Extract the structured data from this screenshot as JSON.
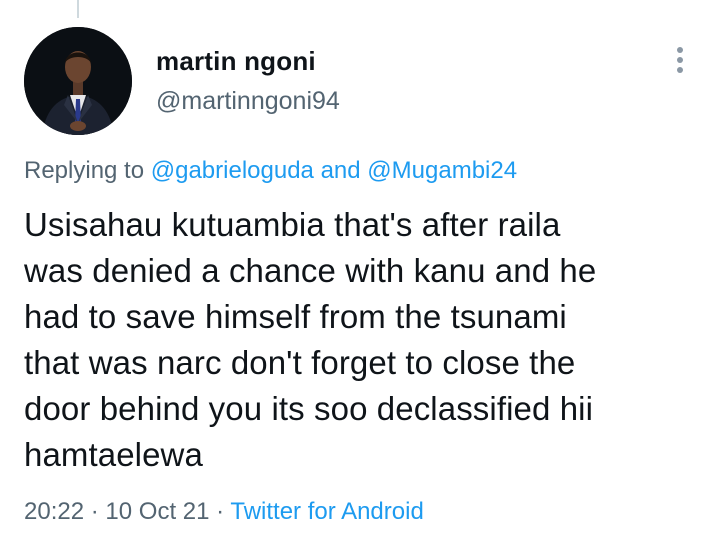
{
  "tweet": {
    "author": {
      "display_name": "martin ngoni",
      "handle": "@martinngoni94"
    },
    "replying": {
      "prefix": "Replying to",
      "mention_1": "@gabrieloguda",
      "conjunction": "and",
      "mention_2": "@Mugambi24"
    },
    "text": "Usisahau kutuambia that's after raila\nwas denied a chance with kanu and he\nhad to save himself from the tsunami\nthat was narc don't forget to close the\ndoor behind you its soo declassified hii\nhamtaelewa",
    "time": "20:22",
    "separator": "·",
    "date": "10 Oct 21",
    "source": "Twitter for Android"
  },
  "icons": {
    "more": "more-vertical-icon"
  },
  "colors": {
    "link": "#1d9bf0",
    "secondary_text": "#536471",
    "primary_text": "#0f1419"
  }
}
